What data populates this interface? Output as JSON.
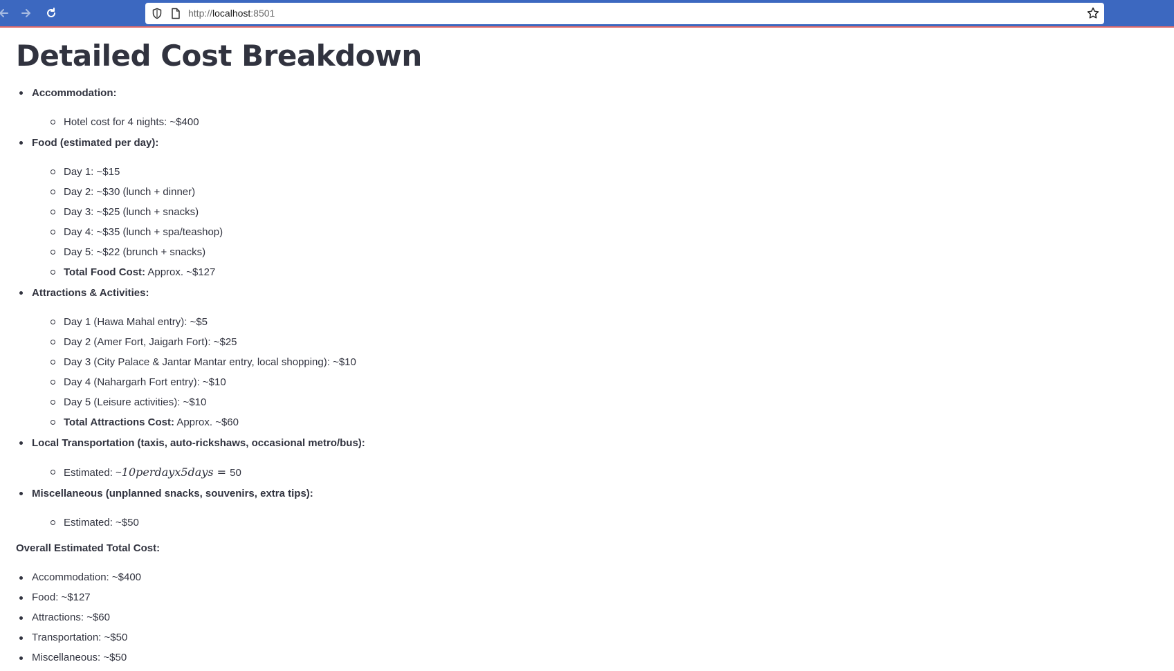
{
  "browser": {
    "url_scheme": "http://",
    "url_host": "localhost",
    "url_port": ":8501"
  },
  "page": {
    "title": "Detailed Cost Breakdown",
    "sections": [
      {
        "heading": "Accommodation:",
        "items": [
          {
            "bold": "",
            "text": "Hotel cost for 4 nights: ~$400"
          }
        ]
      },
      {
        "heading": "Food (estimated per day):",
        "items": [
          {
            "bold": "",
            "text": "Day 1: ~$15"
          },
          {
            "bold": "",
            "text": "Day 2: ~$30 (lunch + dinner)"
          },
          {
            "bold": "",
            "text": "Day 3: ~$25 (lunch + snacks)"
          },
          {
            "bold": "",
            "text": "Day 4: ~$35 (lunch + spa/teashop)"
          },
          {
            "bold": "",
            "text": "Day 5: ~$22 (brunch + snacks)"
          },
          {
            "bold": "Total Food Cost:",
            "text": " Approx. ~$127"
          }
        ]
      },
      {
        "heading": "Attractions & Activities:",
        "items": [
          {
            "bold": "",
            "text": "Day 1 (Hawa Mahal entry): ~$5"
          },
          {
            "bold": "",
            "text": "Day 2 (Amer Fort, Jaigarh Fort): ~$25"
          },
          {
            "bold": "",
            "text": "Day 3 (City Palace & Jantar Mantar entry, local shopping): ~$10"
          },
          {
            "bold": "",
            "text": "Day 4 (Nahargarh Fort entry): ~$10"
          },
          {
            "bold": "",
            "text": "Day 5 (Leisure activities): ~$10"
          },
          {
            "bold": "Total Attractions Cost:",
            "text": " Approx. ~$60"
          }
        ]
      },
      {
        "heading": "Local Transportation (taxis, auto-rickshaws, occasional metro/bus):",
        "items": [
          {
            "bold": "",
            "text": "Estimated: ~",
            "math": "10perdayx5days = ",
            "tail": "50"
          }
        ]
      },
      {
        "heading": "Miscellaneous (unplanned snacks, souvenirs, extra tips):",
        "items": [
          {
            "bold": "",
            "text": "Estimated: ~$50"
          }
        ]
      }
    ],
    "overall_title": "Overall Estimated Total Cost:",
    "summary": [
      "Accommodation: ~$400",
      "Food: ~$127",
      "Attractions: ~$60",
      "Transportation: ~$50",
      "Miscellaneous: ~$50"
    ]
  }
}
